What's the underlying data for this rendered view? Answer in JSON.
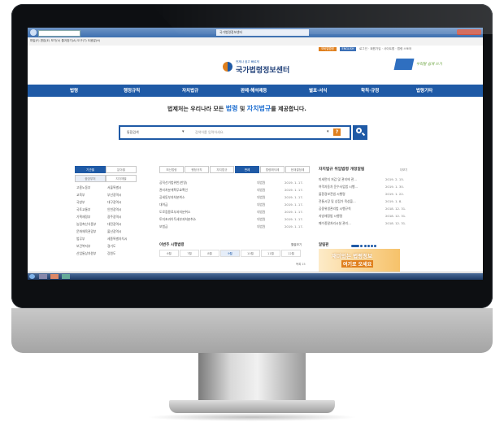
{
  "colors": {
    "nav_blue": "#1f5aa6",
    "accent_orange": "#e0801e",
    "link_blue": "#1f6fd0"
  },
  "browser": {
    "title_tab": "국가법령정보센터",
    "menu_text": "파일(F)  편집(E)  보기(V)  즐겨찾기(A)  도구(T)  도움말(H)",
    "zoom": "100%"
  },
  "header": {
    "util_links": "로그인 · 회원가입 · 사이트맵 · 법령 스토어",
    "logo_small": "언제나 쉽고 빠르게",
    "logo_title": "국가법령정보센터",
    "util_orange": "모바일법령",
    "util_blue": "ENGLISH",
    "banner_text": "우리말 쉽게 쓰기"
  },
  "nav": [
    "법령",
    "행정규칙",
    "자치법규",
    "판례·해석례등",
    "별표·서식",
    "학칙·규정",
    "법령기타"
  ],
  "search": {
    "headline_pre": "법제처는 우리나라 모든 ",
    "headline_blue1": "법령",
    "headline_mid": " 및 ",
    "headline_blue2": "자치법규",
    "headline_post": "를 제공합니다.",
    "category": "통합검색",
    "placeholder": "검색어를 입력하세요.",
    "help": "?"
  },
  "left": {
    "tabs": [
      "기관별",
      "분야별"
    ],
    "subtabs": [
      "중앙부처",
      "지자체별"
    ],
    "col1": [
      "고용노동부",
      "교육부",
      "국방부",
      "국토교통부",
      "기획재정부",
      "농림축산식품부",
      "문화체육관광부",
      "법무부",
      "보건복지부",
      "산업통상자원부"
    ],
    "col2": [
      "서울특별시",
      "부산광역시",
      "대구광역시",
      "인천광역시",
      "광주광역시",
      "대전광역시",
      "울산광역시",
      "세종특별자치시",
      "경기도",
      "강원도"
    ]
  },
  "middle": {
    "tabs": [
      "최신법령",
      "행정규칙",
      "자치법규",
      "판례",
      "법령해석례",
      "헌재결정례"
    ],
    "rows": [
      {
        "title": "공직선거법위반(반영)",
        "court": "대법원",
        "date": "2019. 1. 17."
      },
      {
        "title": "관리처분계획무효확인",
        "court": "대법원",
        "date": "2019. 1. 17."
      },
      {
        "title": "공세동부과처분취소",
        "court": "대법원",
        "date": "2019. 1. 17."
      },
      {
        "title": "대여금",
        "court": "대법원",
        "date": "2019. 1. 17."
      },
      {
        "title": "도로점용료부과처분취소",
        "court": "대법원",
        "date": "2019. 1. 17."
      },
      {
        "title": "토지초과이득세부과처분취소",
        "court": "대법원",
        "date": "2019. 1. 17."
      },
      {
        "title": "보험금",
        "court": "대법원",
        "date": "2019. 1. 17."
      }
    ],
    "calendar_title": "이번주 시행법령",
    "calendar_link": "월별보기",
    "months": [
      "6월",
      "7월",
      "8월",
      "9월",
      "10월",
      "11월",
      "12월"
    ],
    "count_label": "목록 15"
  },
  "right": {
    "title": "자치법규 위임법령 개정알림",
    "more": "더보기",
    "rows": [
      {
        "title": "미세먼지 저감 및 관리에 관...",
        "date": "2019. 2. 15."
      },
      {
        "title": "여객자동차 운수사업법 시행...",
        "date": "2019. 1. 30."
      },
      {
        "title": "물환경보전법 시행령",
        "date": "2019. 1. 22."
      },
      {
        "title": "전통시장 및 상점가 육성을...",
        "date": "2019. 1. 8."
      },
      {
        "title": "공중위생관리법 시행규칙",
        "date": "2018. 12. 31."
      },
      {
        "title": "지방재정법 시행령",
        "date": "2018. 12. 31."
      },
      {
        "title": "폐수종말처리시설 관리...",
        "date": "2018. 12. 31."
      }
    ],
    "popup_title": "알림판",
    "promo1": "재미있는 법령정보",
    "promo2": "여기로 오세요"
  }
}
